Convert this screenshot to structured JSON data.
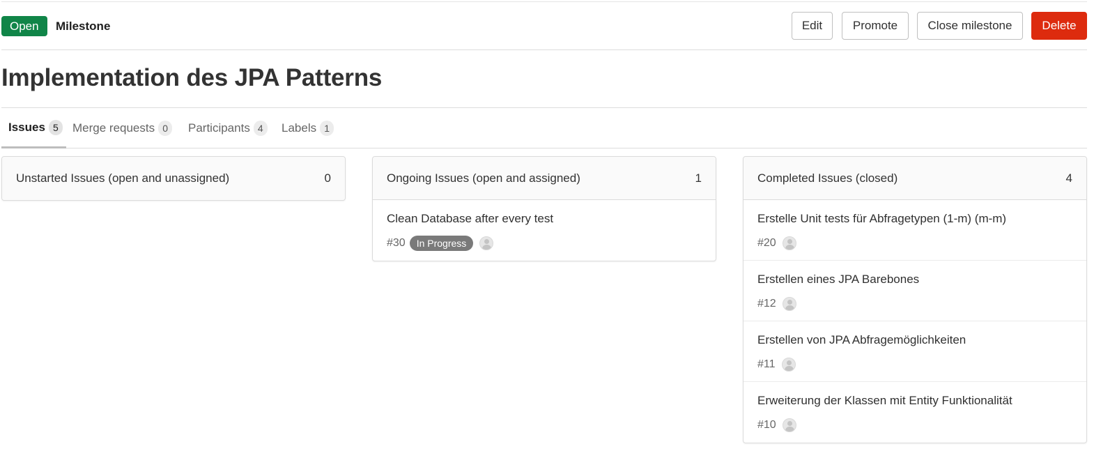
{
  "header": {
    "status_badge": "Open",
    "type_label": "Milestone",
    "buttons": {
      "edit": "Edit",
      "promote": "Promote",
      "close": "Close milestone",
      "delete": "Delete"
    }
  },
  "title": "Implementation des JPA Patterns",
  "tabs": [
    {
      "label": "Issues",
      "count": "5"
    },
    {
      "label": "Merge requests",
      "count": "0"
    },
    {
      "label": "Participants",
      "count": "4"
    },
    {
      "label": "Labels",
      "count": "1"
    }
  ],
  "columns": [
    {
      "title": "Unstarted Issues (open and unassigned)",
      "count": "0",
      "issues": []
    },
    {
      "title": "Ongoing Issues (open and assigned)",
      "count": "1",
      "issues": [
        {
          "title": "Clean Database after every test",
          "ref": "#30",
          "label": "In Progress"
        }
      ]
    },
    {
      "title": "Completed Issues (closed)",
      "count": "4",
      "issues": [
        {
          "title": "Erstelle Unit tests für Abfragetypen (1-m) (m-m)",
          "ref": "#20"
        },
        {
          "title": "Erstellen eines JPA Barebones",
          "ref": "#12"
        },
        {
          "title": "Erstellen von JPA Abfragemöglichkeiten",
          "ref": "#11"
        },
        {
          "title": "Erweiterung der Klassen mit Entity Funktionalität",
          "ref": "#10"
        }
      ]
    }
  ],
  "colors": {
    "status_open": "#108548",
    "delete": "#dd2b0e",
    "label_in_progress": "#7a7a7a"
  }
}
